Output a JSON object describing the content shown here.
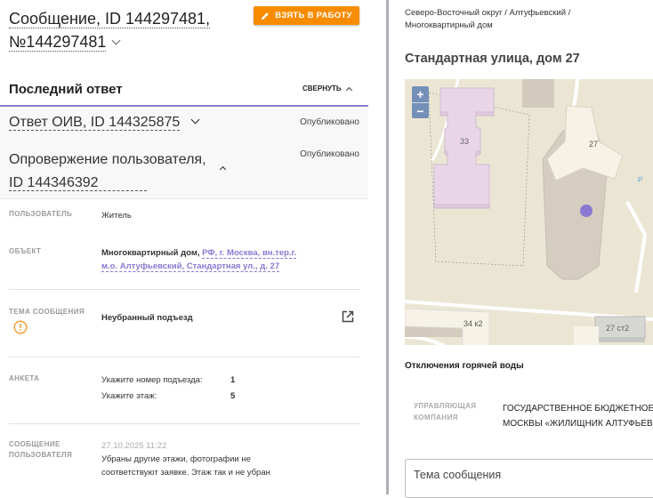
{
  "header": {
    "title_line1": "Сообщение, ID 144297481,",
    "title_line2": "№144297481",
    "take_button": "ВЗЯТЬ В РАБОТУ",
    "accent": "#f78c00"
  },
  "last_reply": {
    "title": "Последний ответ",
    "collapse": "СВЕРНУТЬ",
    "replies": [
      {
        "title": "Ответ ОИВ, ID 144325875",
        "status": "Опубликовано"
      },
      {
        "title_line1": "Опровержение пользователя,",
        "title_line2": "ID 144346392",
        "status": "Опубликовано"
      }
    ]
  },
  "details": {
    "user_label": "ПОЛЬЗОВАТЕЛЬ",
    "user_value": "Житель",
    "object_label": "ОБЪЕКТ",
    "object_type": "Многоквартирный дом,",
    "object_address_line1": "РФ, г. Москва, вн.тер.г.",
    "object_address_line2": "м.о. Алтуфьевский, Стандартная ул., д. 27",
    "topic_label": "ТЕМА СООБЩЕНИЯ",
    "topic_value": "Неубранный подъезд",
    "survey_label": "АНКЕТА",
    "survey": [
      {
        "q": "Укажите номер подъезда:",
        "a": "1"
      },
      {
        "q": "Укажите этаж:",
        "a": "5"
      }
    ],
    "message_label_line1": "СООБЩЕНИЕ",
    "message_label_line2": "ПОЛЬЗОВАТЕЛЯ",
    "message_date": "27.10.2025 11:22",
    "message_line1": "Убраны другие этажи, фотографии не",
    "message_line2": "соответствуют заявке. Этаж так и не убран"
  },
  "right": {
    "crumb_line1": "Северо-Восточный округ / Алтуфьевский /",
    "crumb_line2": "Многоквартирный дом",
    "street": "Стандартная улица, дом 27",
    "map": {
      "zoom_in": "+",
      "zoom_out": "−",
      "labels": [
        "33",
        "27",
        "34 к2",
        "27 ст2",
        "P"
      ],
      "marker_color": "#8a78d3"
    },
    "hot_water": "Отключения горячей воды",
    "mc_label_line1": "УПРАВЛЯЮЩАЯ",
    "mc_label_line2": "КОМПАНИЯ",
    "mc_line1": "ГОСУДАРСТВЕННОЕ БЮДЖЕТНОЕ У",
    "mc_line2": "МОСКВЫ «ЖИЛИЩНИК АЛТУФЬЕВ",
    "topic_placeholder": "Тема сообщения"
  }
}
